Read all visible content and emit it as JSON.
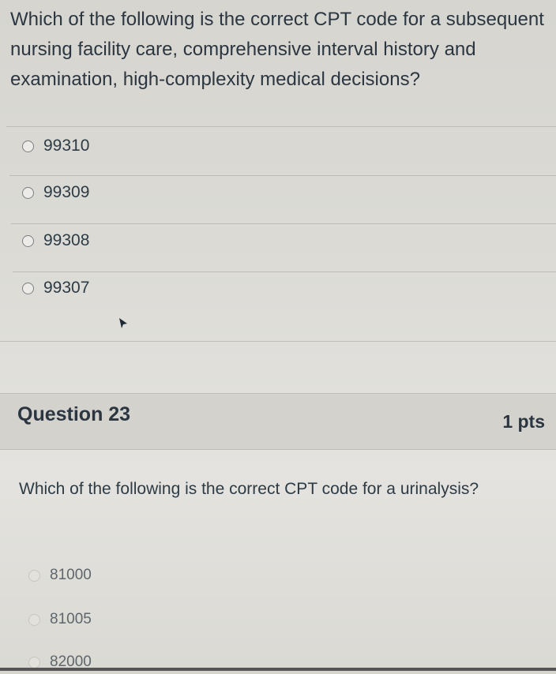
{
  "question_1": {
    "prompt": "Which of the following is the correct CPT code for a subsequent nursing facility care, comprehensive interval history and examination, high-complexity medical decisions?",
    "answers": [
      "99310",
      "99309",
      "99308",
      "99307"
    ]
  },
  "question_2": {
    "title": "Question 23",
    "points": "1 pts",
    "prompt": "Which of the following is the correct CPT code for a urinalysis?",
    "answers": [
      "81000",
      "81005",
      "82000"
    ]
  },
  "icons": {
    "radio": "radio-button-icon",
    "cursor": "mouse-pointer-icon"
  }
}
